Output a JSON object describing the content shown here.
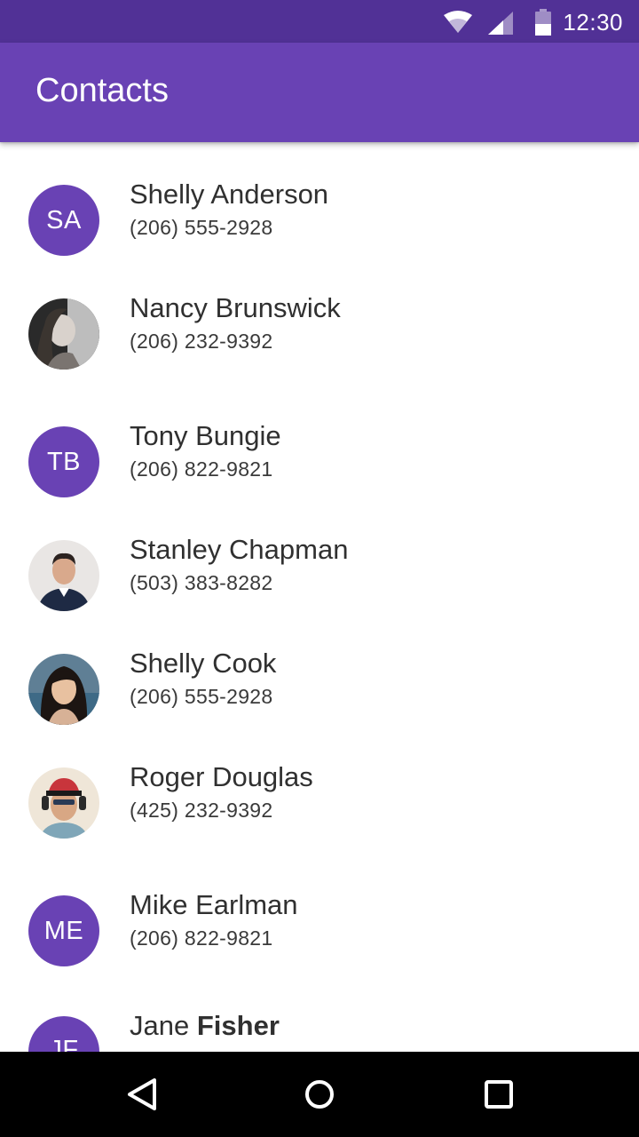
{
  "status_bar": {
    "time": "12:30",
    "icons": [
      "wifi-icon",
      "signal-icon",
      "battery-icon"
    ],
    "background": "#513196"
  },
  "app_bar": {
    "title": "Contacts",
    "background": "#6942b4"
  },
  "contacts": [
    {
      "first": "Shelly",
      "last": "Anderson",
      "phone": "(206) 555-2928",
      "avatar": "initials",
      "initials": "SA"
    },
    {
      "first": "Nancy",
      "last": "Brunswick",
      "phone": "(206) 232-9392",
      "avatar": "photo"
    },
    {
      "first": "Tony",
      "last": "Bungie",
      "phone": "(206) 822-9821",
      "avatar": "initials",
      "initials": "TB"
    },
    {
      "first": "Stanley",
      "last": "Chapman",
      "phone": "(503) 383-8282",
      "avatar": "photo"
    },
    {
      "first": "Shelly",
      "last": "Cook",
      "phone": "(206) 555-2928",
      "avatar": "photo"
    },
    {
      "first": "Roger",
      "last": "Douglas",
      "phone": "(425) 232-9392",
      "avatar": "photo"
    },
    {
      "first": "Mike",
      "last": "Earlman",
      "phone": "(206) 822-9821",
      "avatar": "initials",
      "initials": "ME"
    },
    {
      "first": "Jane",
      "last": "Fisher",
      "avatar": "initials",
      "initials": "JF"
    }
  ],
  "nav_bar": {
    "buttons": [
      "back-icon",
      "home-icon",
      "recents-icon"
    ]
  },
  "colors": {
    "accent": "#6942b4",
    "status_bar": "#513196",
    "text_primary": "#303030"
  }
}
